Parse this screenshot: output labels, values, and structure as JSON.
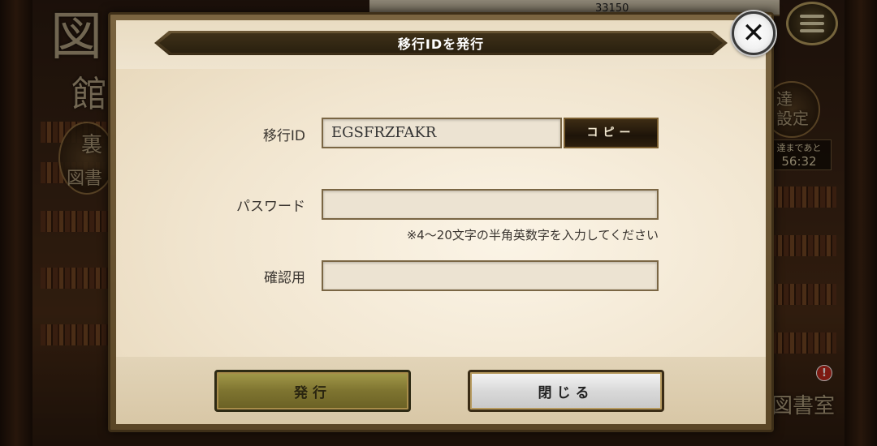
{
  "background": {
    "coin_count": "33150",
    "side_text_top": "図",
    "side_text_library": "館",
    "side_text_ura": "裏",
    "side_text_tosho": "図書",
    "right_badge_text": "達\n設定",
    "timer_label": "達まであと",
    "timer_value": "56:32",
    "right_bottom_text": "図書室",
    "notification_mark": "!"
  },
  "dialog": {
    "title": "移行IDを発行",
    "transfer_id_label": "移行ID",
    "transfer_id_value": "EGSFRZFAKR",
    "copy_button_label": "コピー",
    "password_label": "パスワード",
    "password_value": "",
    "password_hint": "※4～20文字の半角英数字を入力してください",
    "confirm_label": "確認用",
    "confirm_value": "",
    "issue_button_label": "発行",
    "close_button_label": "閉じる"
  },
  "colors": {
    "title_ribbon": "#3e3018",
    "issue_button": "#7e7430",
    "close_button": "#d9d9d9",
    "dialog_bg": "#f1e5cf"
  }
}
